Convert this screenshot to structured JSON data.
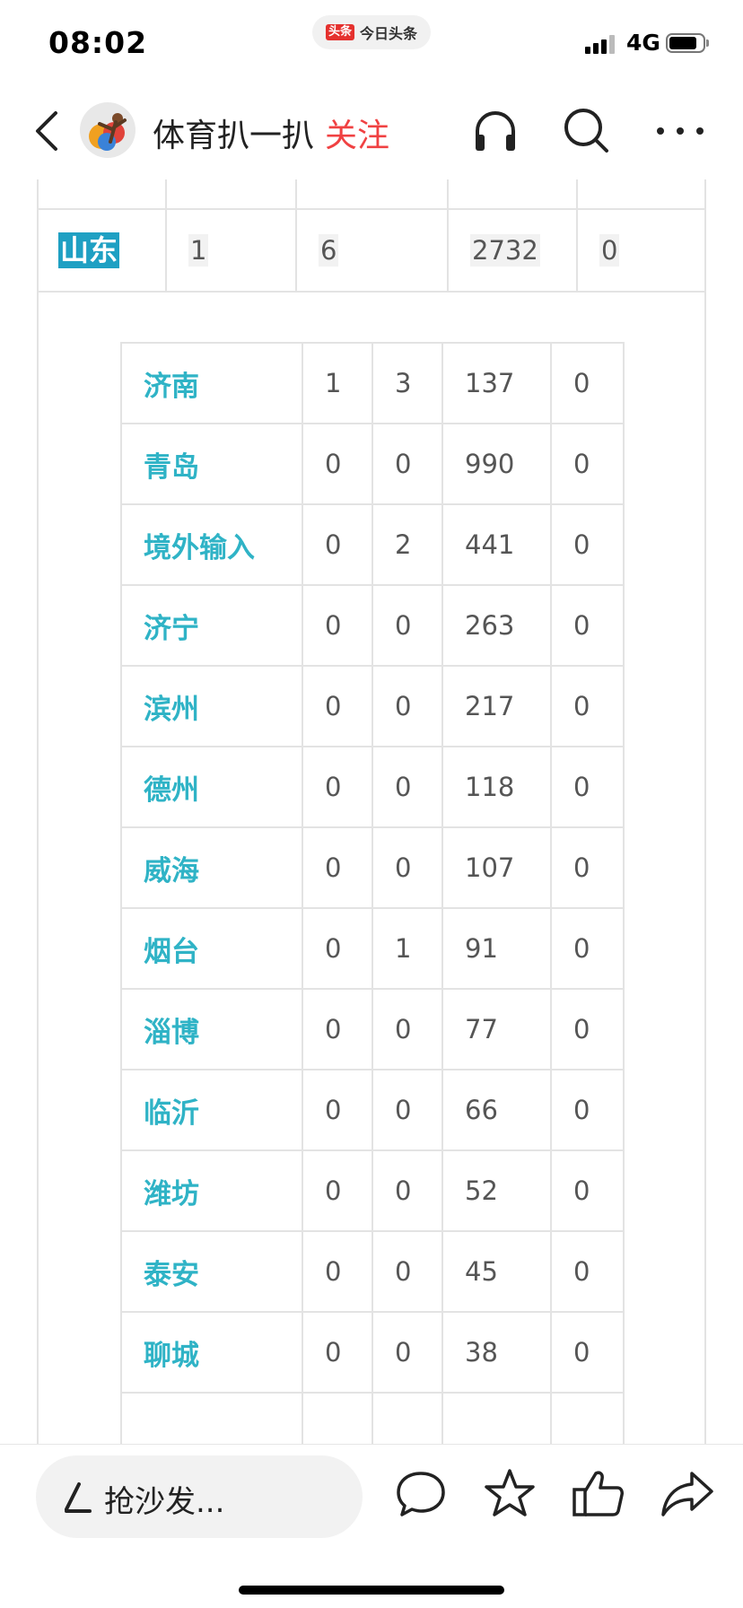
{
  "status_bar": {
    "time": "08:02",
    "app_badge": "头条",
    "app_name": "今日头条",
    "network": "4G"
  },
  "nav": {
    "author": "体育扒一扒",
    "follow_label": "关注",
    "icons": [
      "back-icon",
      "headphones-icon",
      "search-icon",
      "more-icon"
    ]
  },
  "province_row": {
    "name": "山东",
    "new_confirmed": "1",
    "new_asymptomatic": "6",
    "cumulative": "2732",
    "deaths": "0"
  },
  "cities": [
    {
      "name": "济南",
      "v1": "1",
      "v2": "3",
      "v3": "137",
      "v4": "0"
    },
    {
      "name": "青岛",
      "v1": "0",
      "v2": "0",
      "v3": "990",
      "v4": "0"
    },
    {
      "name": "境外输入",
      "v1": "0",
      "v2": "2",
      "v3": "441",
      "v4": "0"
    },
    {
      "name": "济宁",
      "v1": "0",
      "v2": "0",
      "v3": "263",
      "v4": "0"
    },
    {
      "name": "滨州",
      "v1": "0",
      "v2": "0",
      "v3": "217",
      "v4": "0"
    },
    {
      "name": "德州",
      "v1": "0",
      "v2": "0",
      "v3": "118",
      "v4": "0"
    },
    {
      "name": "威海",
      "v1": "0",
      "v2": "0",
      "v3": "107",
      "v4": "0"
    },
    {
      "name": "烟台",
      "v1": "0",
      "v2": "1",
      "v3": "91",
      "v4": "0"
    },
    {
      "name": "淄博",
      "v1": "0",
      "v2": "0",
      "v3": "77",
      "v4": "0"
    },
    {
      "name": "临沂",
      "v1": "0",
      "v2": "0",
      "v3": "66",
      "v4": "0"
    },
    {
      "name": "潍坊",
      "v1": "0",
      "v2": "0",
      "v3": "52",
      "v4": "0"
    },
    {
      "name": "泰安",
      "v1": "0",
      "v2": "0",
      "v3": "45",
      "v4": "0"
    },
    {
      "name": "聊城",
      "v1": "0",
      "v2": "0",
      "v3": "38",
      "v4": "0"
    }
  ],
  "bottom_bar": {
    "comment_placeholder": "抢沙发...",
    "icons": [
      "comment-icon",
      "star-icon",
      "like-icon",
      "share-icon"
    ]
  },
  "colors": {
    "follow": "#f04142",
    "city_link": "#2fb3c6",
    "province_highlight": "#1fa0c3",
    "border": "#e3e3e3"
  }
}
